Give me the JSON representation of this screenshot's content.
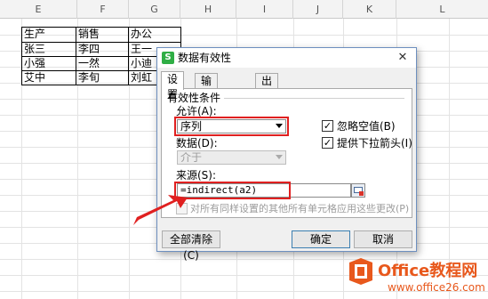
{
  "sheet": {
    "columns": [
      "E",
      "F",
      "G",
      "H",
      "I",
      "J",
      "K",
      "L"
    ],
    "cells": [
      [
        "生产",
        "销售",
        "办公"
      ],
      [
        "张三",
        "李四",
        "王一"
      ],
      [
        "小强",
        "一然",
        "小迪"
      ],
      [
        "艾中",
        "李旬",
        "刘虹"
      ]
    ]
  },
  "dialog": {
    "app_icon_glyph": "S",
    "title": "数据有效性",
    "close_glyph": "✕",
    "tabs": [
      "设置",
      "输入信息",
      "出错警告"
    ],
    "section_title": "有效性条件",
    "allow_label": "允许(A):",
    "allow_value": "序列",
    "data_label": "数据(D):",
    "data_value": "介于",
    "ignore_blank_label": "忽略空值(B)",
    "ignore_blank_checked": true,
    "dropdown_arrow_label": "提供下拉箭头(I)",
    "dropdown_arrow_checked": true,
    "source_label": "来源(S):",
    "source_value": "=indirect(a2)",
    "apply_all_label": "对所有同样设置的其他所有单元格应用这些更改(P)",
    "apply_all_checked": false,
    "clear_all_button": "全部清除(C)",
    "ok_button": "确定",
    "cancel_button": "取消",
    "check_glyph": "✓",
    "highlight_color": "#e02020"
  },
  "watermark": {
    "brand": "Office教程网",
    "url": "www.office26.com"
  }
}
